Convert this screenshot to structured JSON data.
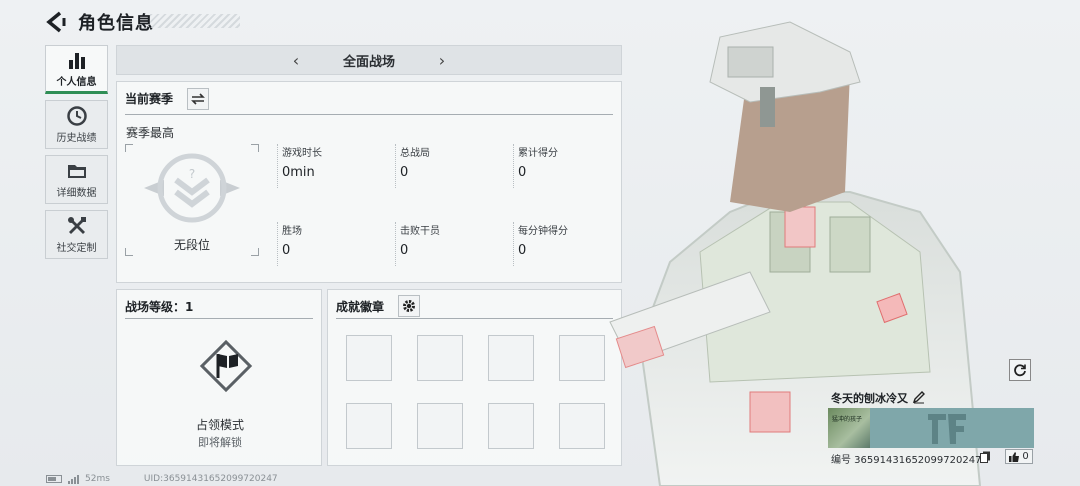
{
  "header": {
    "title": "角色信息"
  },
  "nav": {
    "items": [
      {
        "label": "个人信息",
        "icon": "bar-chart-icon",
        "active": true
      },
      {
        "label": "历史战绩",
        "icon": "history-clock-icon",
        "active": false
      },
      {
        "label": "详细数据",
        "icon": "folder-icon",
        "active": false
      },
      {
        "label": "社交定制",
        "icon": "tools-icon",
        "active": false
      }
    ]
  },
  "mode_bar": {
    "current": "全面战场",
    "prev_icon": "chevron-left-icon",
    "next_icon": "chevron-right-icon"
  },
  "season": {
    "heading": "当前赛季",
    "best_label": "赛季最高",
    "rank_name": "无段位",
    "stats": [
      {
        "label": "游戏时长",
        "value": "0min"
      },
      {
        "label": "总战局",
        "value": "0"
      },
      {
        "label": "累计得分",
        "value": "0"
      },
      {
        "label": "胜场",
        "value": "0"
      },
      {
        "label": "击败干员",
        "value": "0"
      },
      {
        "label": "每分钟得分",
        "value": "0"
      }
    ]
  },
  "battlefield_level": {
    "heading": "战场等级：1",
    "mode_name": "占领模式",
    "mode_status": "即将解锁"
  },
  "achievements": {
    "heading": "成就徽章",
    "slot_count": 8
  },
  "profile_card": {
    "name": "冬天的刨冰冷又",
    "thumb_text": "猛冲的孩子",
    "id_text": "编号 365914316520997202​47",
    "likes": "0"
  },
  "status_bar": {
    "ping": "52ms",
    "uid": "UID:365914316520997202​47",
    "battery_fraction": 0.55
  },
  "colors": {
    "accent": "#2e8e55",
    "banner": "#7fa7aa"
  }
}
